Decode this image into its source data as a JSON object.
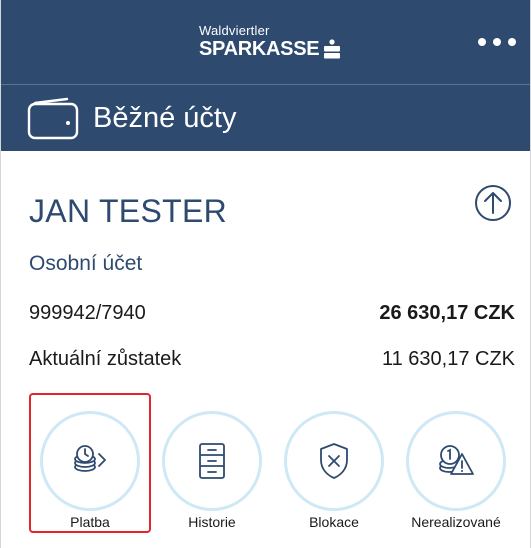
{
  "header": {
    "logo_small": "Waldviertler",
    "logo_big": "SPARKASSE",
    "more_icon": "more-horizontal-icon"
  },
  "section": {
    "title": "Běžné účty",
    "icon": "wallet-icon"
  },
  "account": {
    "holder": "JAN TESTER",
    "type": "Osobní účet",
    "number": "999942/7940",
    "balance": "26 630,17 CZK",
    "current_label": "Aktuální zůstatek",
    "current_value": "11 630,17 CZK"
  },
  "actions": [
    {
      "label": "Platba",
      "icon": "payment-coins-clock-icon"
    },
    {
      "label": "Historie",
      "icon": "filing-cabinet-icon"
    },
    {
      "label": "Blokace",
      "icon": "shield-x-icon"
    },
    {
      "label": "Nerealizované",
      "icon": "coins-warning-icon"
    }
  ],
  "colors": {
    "header_bg": "#2e4a6f",
    "accent_text": "#2e4a6f",
    "circle_border": "#cfe8f5",
    "highlight": "#e4232b"
  }
}
